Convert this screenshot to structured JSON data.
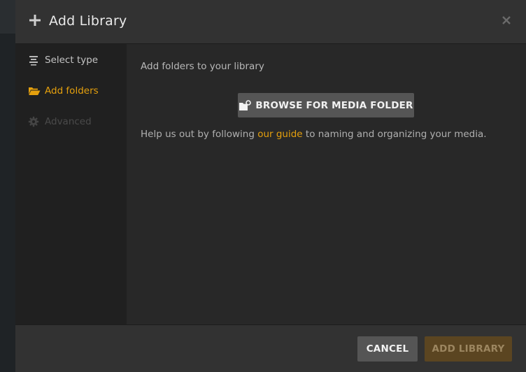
{
  "header": {
    "title": "Add Library",
    "close_label": "×"
  },
  "sidebar": {
    "items": [
      {
        "label": "Select type",
        "icon": "list-icon",
        "state": "done"
      },
      {
        "label": "Add folders",
        "icon": "folder-open-icon",
        "state": "active"
      },
      {
        "label": "Advanced",
        "icon": "gear-icon",
        "state": "disabled"
      }
    ]
  },
  "content": {
    "heading": "Add folders to your library",
    "browse_button_label": "BROWSE FOR MEDIA FOLDER",
    "help_prefix": "Help us out by following ",
    "help_link": "our guide",
    "help_suffix": " to naming and organizing your media."
  },
  "footer": {
    "cancel_label": "CANCEL",
    "add_label": "ADD LIBRARY"
  },
  "colors": {
    "accent": "#e5a00d",
    "header_bg": "#323232",
    "sidebar_bg": "#202020",
    "content_bg": "#282828",
    "button_bg": "#555555",
    "add_disabled_bg": "#5b4521"
  }
}
